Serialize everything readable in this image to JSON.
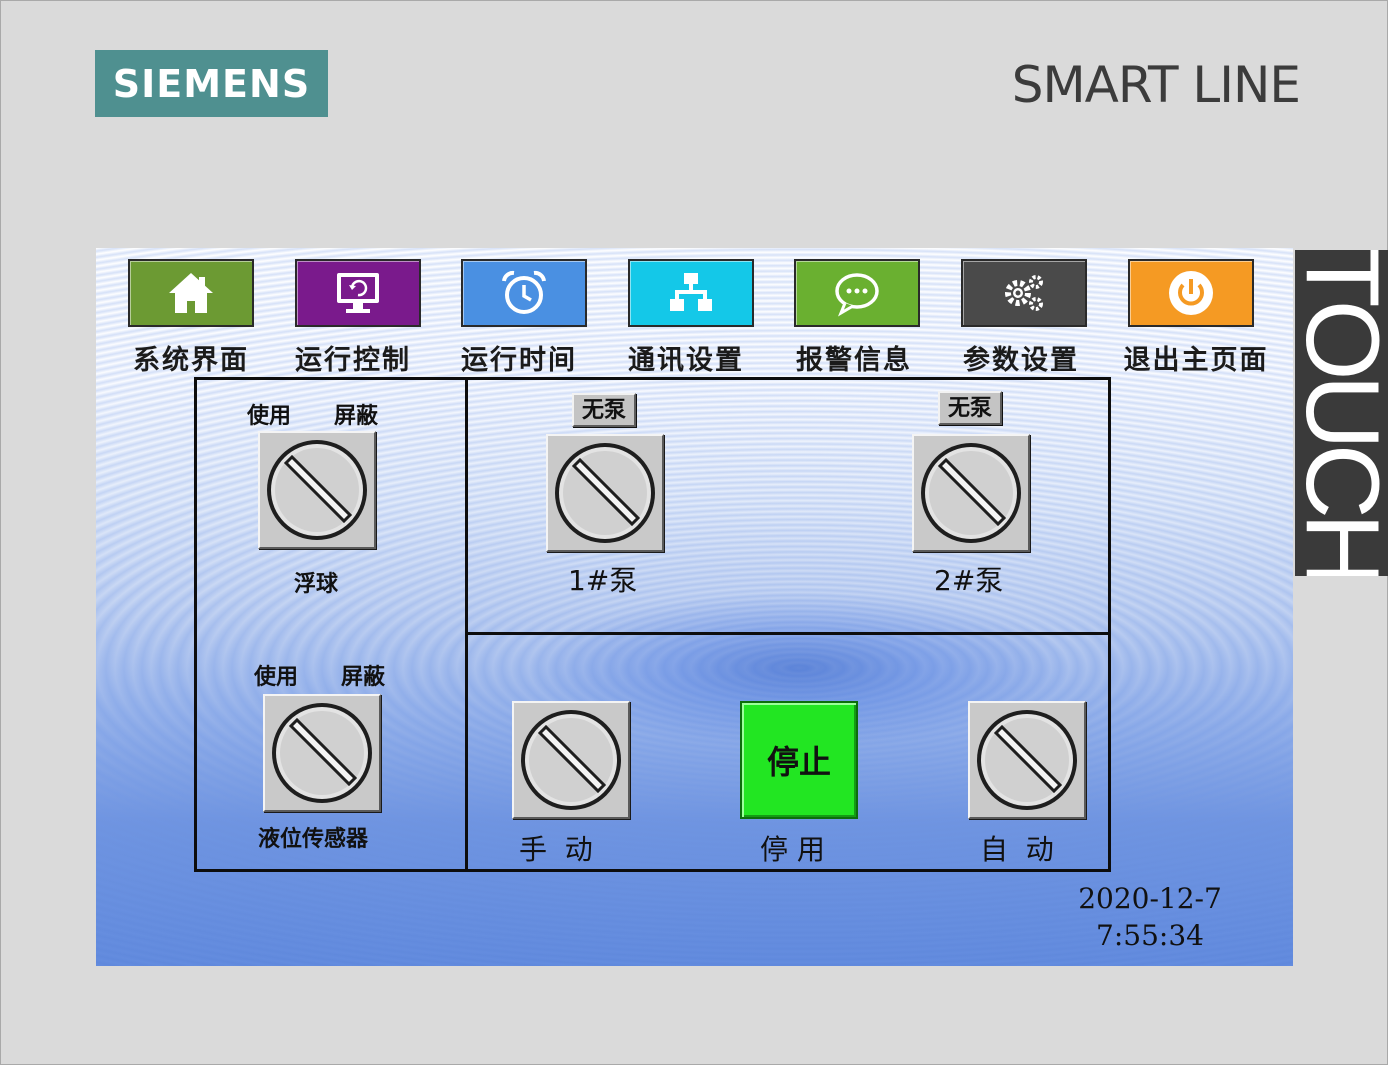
{
  "brand": {
    "logo": "SIEMENS",
    "product": "SMART LINE",
    "touch": "TOUCH"
  },
  "nav": [
    {
      "label": "系统界面",
      "icon": "home-icon",
      "color": "#6c9a33"
    },
    {
      "label": "运行控制",
      "icon": "monitor-refresh-icon",
      "color": "#7a1a8c"
    },
    {
      "label": "运行时间",
      "icon": "alarm-clock-icon",
      "color": "#4a90e2"
    },
    {
      "label": "通讯设置",
      "icon": "network-icon",
      "color": "#14c8e8"
    },
    {
      "label": "报警信息",
      "icon": "chat-bubble-icon",
      "color": "#6ab030"
    },
    {
      "label": "参数设置",
      "icon": "gears-icon",
      "color": "#4a4a4a"
    },
    {
      "label": "退出主页面",
      "icon": "power-icon",
      "color": "#f59a23"
    }
  ],
  "left_panel": {
    "float": {
      "use": "使用",
      "mask": "屏蔽",
      "name": "浮球"
    },
    "sensor": {
      "use": "使用",
      "mask": "屏蔽",
      "name": "液位传感器"
    }
  },
  "pumps": [
    {
      "status": "无泵",
      "name": "1#泵"
    },
    {
      "status": "无泵",
      "name": "2#泵"
    }
  ],
  "modes": {
    "manual": "手  动",
    "stop_button": "停止",
    "stop_label": "停 用",
    "auto": "自  动"
  },
  "datetime": {
    "date": "2020-12-7",
    "time": "7:55:34"
  }
}
